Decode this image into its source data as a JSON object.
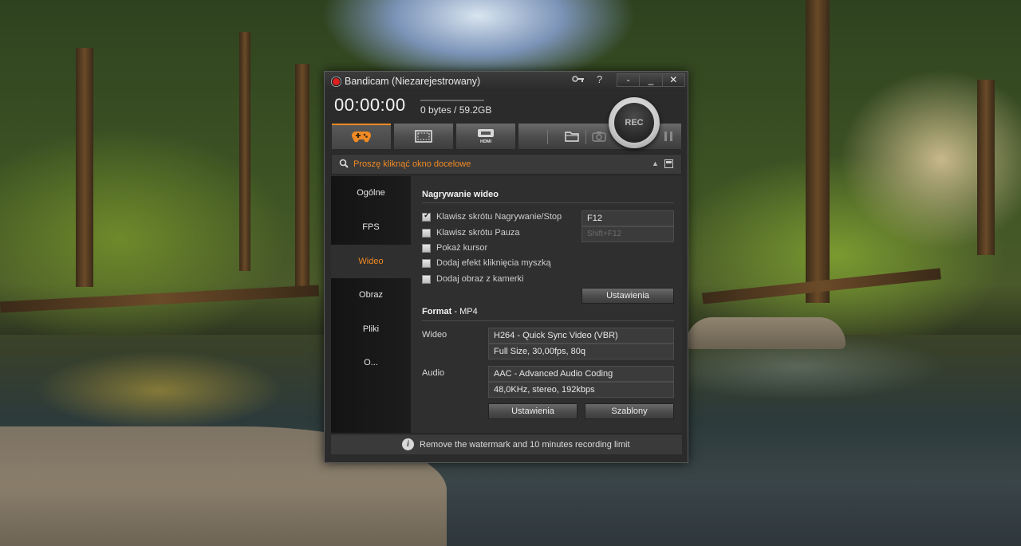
{
  "window": {
    "title": "Bandicam (Niezarejestrowany)",
    "icons": [
      "key-icon",
      "help-icon"
    ],
    "controls": [
      "-",
      "_",
      "✕"
    ]
  },
  "status": {
    "timer": "00:00:00",
    "size": "0 bytes / 59.2GB",
    "rec_label": "REC"
  },
  "toolbar": {
    "modes": [
      {
        "name": "game-mode",
        "icon": "gamepad-icon",
        "active": true
      },
      {
        "name": "screen-mode",
        "icon": "screen-rectangle-icon",
        "active": false
      },
      {
        "name": "hdmi-mode",
        "icon": "hdmi-device-icon",
        "active": false
      }
    ],
    "actions": [
      "folder-icon",
      "camera-icon",
      "pause-icon"
    ],
    "accent": "#f08a24"
  },
  "target": {
    "text": "Proszę kliknąć okno docelowe",
    "collapse": "▲"
  },
  "sidebar": {
    "items": [
      {
        "label": "Ogólne"
      },
      {
        "label": "FPS"
      },
      {
        "label": "Wideo"
      },
      {
        "label": "Obraz"
      },
      {
        "label": "Pliki"
      },
      {
        "label": "O..."
      }
    ],
    "active_index": 2
  },
  "recording": {
    "title": "Nagrywanie wideo",
    "options": [
      {
        "label": "Klawisz skrótu Nagrywanie/Stop",
        "checked": true,
        "hotkey": "F12"
      },
      {
        "label": "Klawisz skrótu Pauza",
        "checked": false,
        "hotkey": "Shift+F12"
      },
      {
        "label": "Pokaż kursor",
        "checked": false
      },
      {
        "label": "Dodaj efekt kliknięcia myszką",
        "checked": false
      },
      {
        "label": "Dodaj obraz z kamerki",
        "checked": false
      }
    ],
    "settings_button": "Ustawienia"
  },
  "format": {
    "title": "Format",
    "container": "- MP4",
    "video_label": "Wideo",
    "video_codec": "H264 - Quick Sync Video (VBR)",
    "video_details": "Full Size, 30,00fps, 80q",
    "audio_label": "Audio",
    "audio_codec": "AAC - Advanced Audio Coding",
    "audio_details": "48,0KHz, stereo, 192kbps",
    "settings_button": "Ustawienia",
    "templates_button": "Szablony"
  },
  "footer": {
    "text": "Remove the watermark and 10 minutes recording limit"
  }
}
